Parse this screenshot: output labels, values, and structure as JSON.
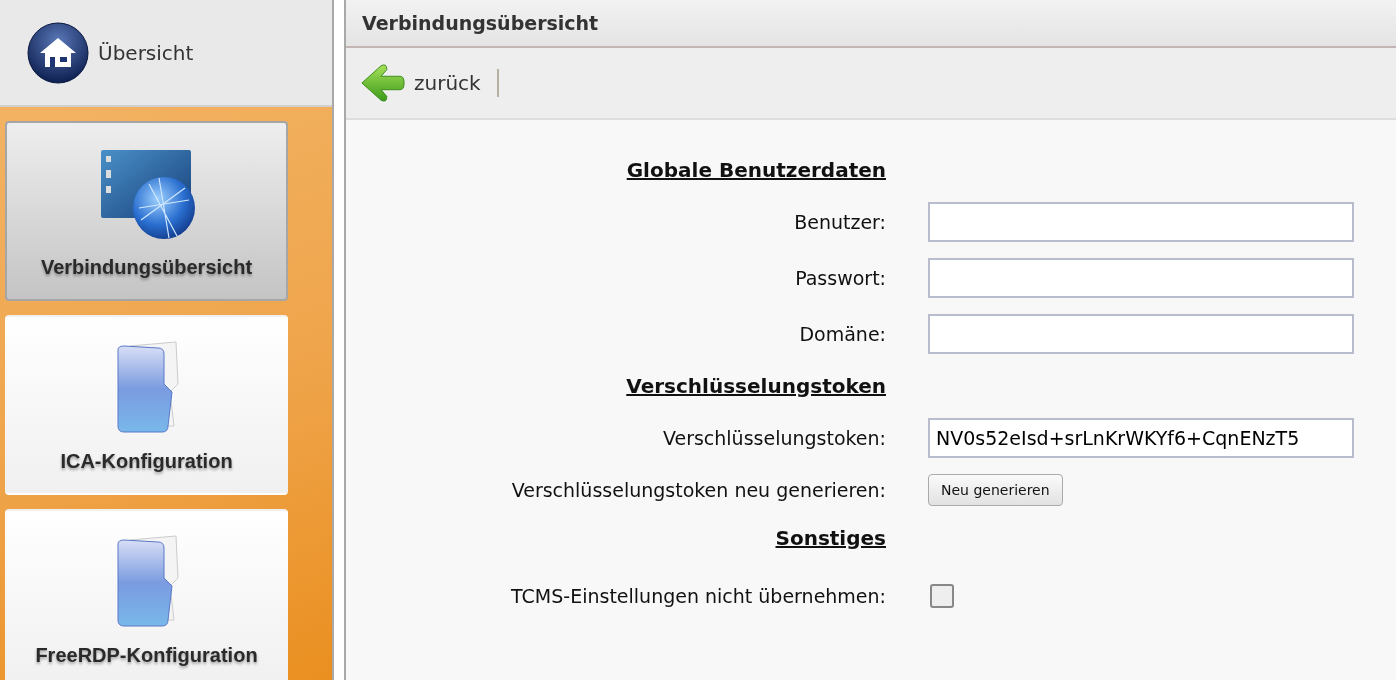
{
  "sidebar": {
    "home": {
      "label": "Übersicht"
    },
    "items": [
      {
        "label": "Verbindungsübersicht",
        "kind": "network",
        "selected": true
      },
      {
        "label": "ICA-Konfiguration",
        "kind": "folder",
        "selected": false
      },
      {
        "label": "FreeRDP-Konfiguration",
        "kind": "folder",
        "selected": false
      }
    ]
  },
  "main": {
    "title": "Verbindungsübersicht",
    "toolbar": {
      "back": "zurück"
    },
    "rows": [
      {
        "kind": "heading",
        "label": "Globale Benutzerdaten"
      },
      {
        "kind": "text",
        "label": "Benutzer:"
      },
      {
        "kind": "password",
        "label": "Passwort:"
      },
      {
        "kind": "text",
        "label": "Domäne:"
      },
      {
        "kind": "heading",
        "label": "Verschlüsselungstoken"
      },
      {
        "kind": "text",
        "label": "Verschlüsselungstoken:",
        "value": "NV0s52eIsd+srLnKrWKYf6+CqnENzT5"
      },
      {
        "kind": "button",
        "label": "Verschlüsselungstoken neu generieren:",
        "button": "Neu generieren"
      },
      {
        "kind": "heading",
        "label": "Sonstiges"
      },
      {
        "kind": "checkbox",
        "label": "TCMS-Einstellungen nicht übernehmen:",
        "checked": false
      }
    ]
  }
}
